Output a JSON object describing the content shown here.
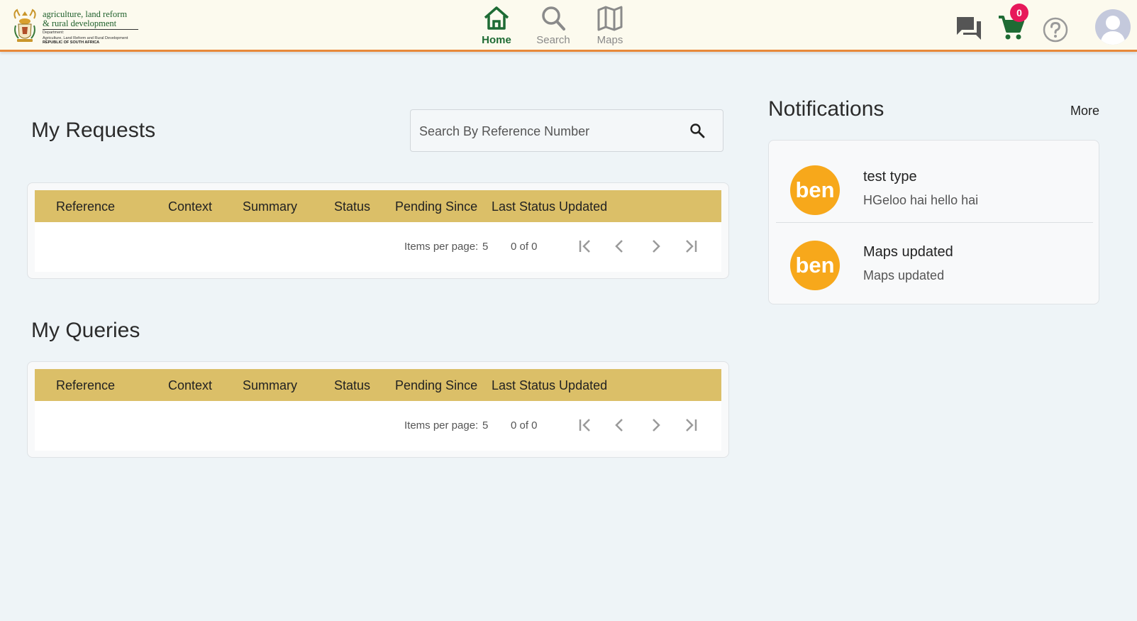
{
  "header": {
    "logo": {
      "line1": "agriculture, land reform",
      "line2": "& rural development",
      "sub1": "Department:",
      "sub2": "Agriculture, Land Reform and Rural Development",
      "sub3": "REPUBLIC OF SOUTH AFRICA"
    },
    "nav": [
      {
        "label": "Home",
        "icon": "home-icon",
        "active": true
      },
      {
        "label": "Search",
        "icon": "search-icon",
        "active": false
      },
      {
        "label": "Maps",
        "icon": "map-icon",
        "active": false
      }
    ],
    "cart_count": "0",
    "icons": [
      "chat-icon",
      "cart-icon",
      "help-icon",
      "user-avatar"
    ]
  },
  "requests": {
    "title": "My Requests",
    "search_placeholder": "Search By Reference Number",
    "columns": [
      "Reference",
      "Context",
      "Summary",
      "Status",
      "Pending Since",
      "Last Status Updated"
    ],
    "items_per_page_label": "Items per page:",
    "items_per_page": "5",
    "range": "0 of 0"
  },
  "queries": {
    "title": "My Queries",
    "columns": [
      "Reference",
      "Context",
      "Summary",
      "Status",
      "Pending Since",
      "Last Status Updated"
    ],
    "items_per_page_label": "Items per page:",
    "items_per_page": "5",
    "range": "0 of 0"
  },
  "notifications": {
    "title": "Notifications",
    "more_label": "More",
    "items": [
      {
        "avatar": "ben",
        "title": "test type",
        "body": "HGeloo hai hello hai"
      },
      {
        "avatar": "ben",
        "title": "Maps updated",
        "body": "Maps updated"
      }
    ]
  },
  "colors": {
    "header_bg": "#fcfaee",
    "header_border": "#e8893a",
    "table_header": "#dbbf68",
    "brand_green": "#1e6b34",
    "avatar_orange": "#f7a81b",
    "badge_pink": "#e7185a",
    "page_bg": "#eef4f7"
  }
}
